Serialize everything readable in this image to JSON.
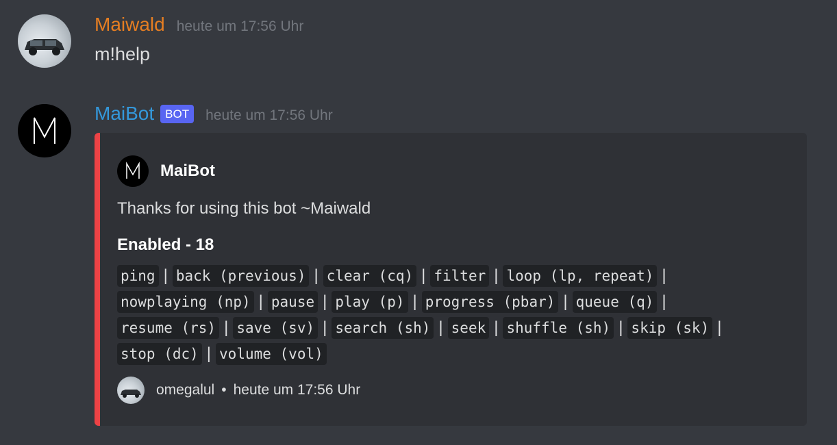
{
  "messages": {
    "user_msg": {
      "username": "Maiwald",
      "timestamp": "heute um 17:56 Uhr",
      "content": "m!help",
      "avatar_icon": "car-avatar-icon"
    },
    "bot_msg": {
      "username": "MaiBot",
      "badge": "BOT",
      "timestamp": "heute um 17:56 Uhr",
      "avatar_icon": "m-logo-icon"
    }
  },
  "embed": {
    "accent_color": "#ed4245",
    "author": "MaiBot",
    "description": "Thanks for using this bot ~Maiwald",
    "field_name": "Enabled - 18",
    "commands": [
      [
        "ping",
        "back (previous)",
        "clear (cq)",
        "filter",
        "loop (lp, repeat)"
      ],
      [
        "nowplaying (np)",
        "pause",
        "play (p)",
        "progress (pbar)",
        "queue (q)"
      ],
      [
        "resume (rs)",
        "save (sv)",
        "search (sh)",
        "seek",
        "shuffle (sh)",
        "skip (sk)"
      ],
      [
        "stop (dc)",
        "volume (vol)"
      ]
    ],
    "separator": "|",
    "footer": {
      "text": "omegalul",
      "dot": "•",
      "timestamp": "heute um 17:56 Uhr"
    }
  },
  "colors": {
    "background": "#36393f",
    "embed_bg": "#2f3136",
    "user_name": "#e67e22",
    "bot_name": "#3498db",
    "bot_badge": "#5865f2"
  }
}
